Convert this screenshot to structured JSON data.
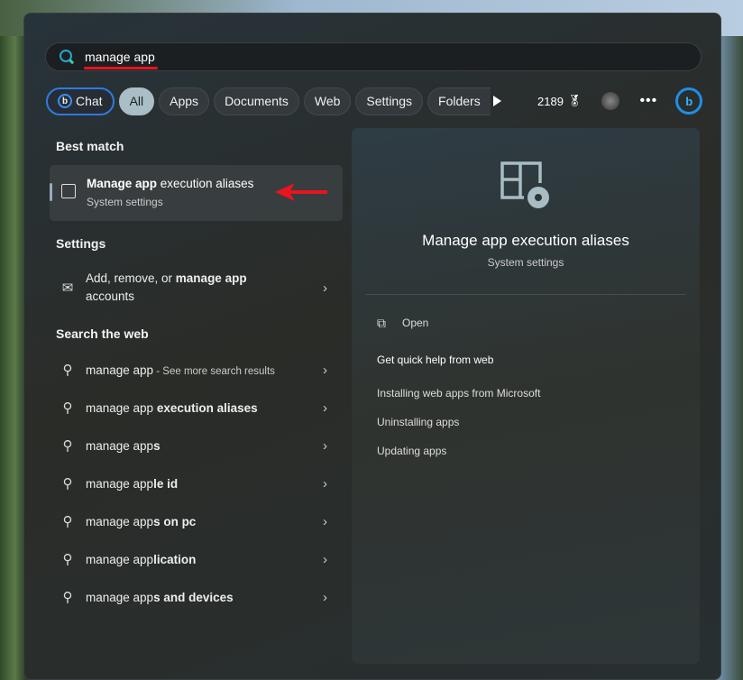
{
  "search": {
    "value": "manage app"
  },
  "filters": {
    "chat": "Chat",
    "tabs": [
      "All",
      "Apps",
      "Documents",
      "Web",
      "Settings",
      "Folders"
    ],
    "points": "2189"
  },
  "best_match": {
    "header": "Best match",
    "title_bold": "Manage app",
    "title_rest": " execution aliases",
    "subtitle": "System settings"
  },
  "settings": {
    "header": "Settings",
    "item_pre": "Add, remove, or ",
    "item_bold": "manage app",
    "item_post": "accounts"
  },
  "web": {
    "header": "Search the web",
    "see_more": " - See more search results",
    "items": [
      {
        "pre": "manage app",
        "bold": ""
      },
      {
        "pre": "manage app ",
        "bold": "execution aliases"
      },
      {
        "pre": "manage app",
        "bold": "s"
      },
      {
        "pre": "manage app",
        "bold": "le id"
      },
      {
        "pre": "manage app",
        "bold": "s on pc"
      },
      {
        "pre": "manage app",
        "bold": "lication"
      },
      {
        "pre": "manage app",
        "bold": "s and devices"
      }
    ]
  },
  "preview": {
    "title": "Manage app execution aliases",
    "subtitle": "System settings",
    "open": "Open",
    "help_header": "Get quick help from web",
    "links": [
      "Installing web apps from Microsoft",
      "Uninstalling apps",
      "Updating apps"
    ]
  },
  "colors": {
    "annotation": "#e8141e",
    "accent": "#2f7ae0"
  }
}
